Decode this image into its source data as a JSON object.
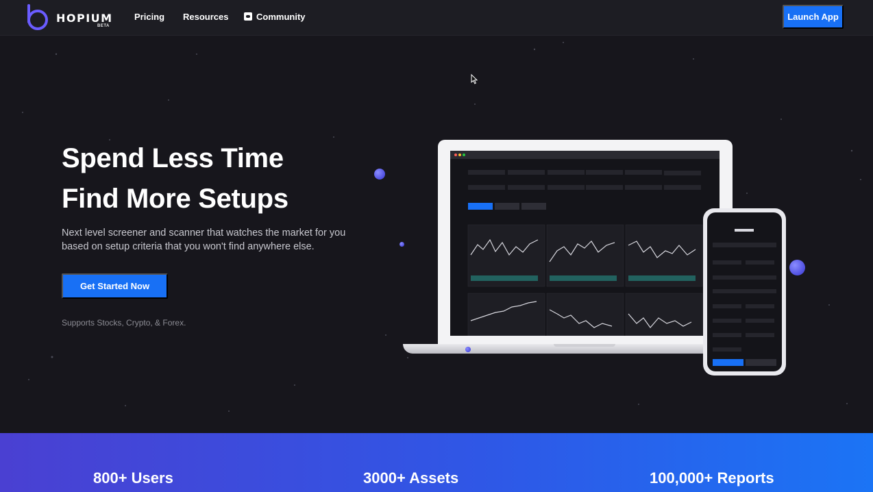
{
  "nav": {
    "logo_text": "HOPIUM",
    "logo_badge": "BETA",
    "links": [
      "Pricing",
      "Resources",
      "Community"
    ],
    "launch_label": "Launch App"
  },
  "hero": {
    "title_line1": "Spend Less Time",
    "title_line2": "Find More Setups",
    "subtitle": "Next level screener and scanner that watches the market for you based on setup criteria that you won't find anywhere else.",
    "cta_label": "Get Started Now",
    "supports": "Supports Stocks, Crypto, & Forex."
  },
  "stats": {
    "users": "800+ Users",
    "assets": "3000+ Assets",
    "reports": "100,000+ Reports"
  },
  "colors": {
    "accent": "#1870f5",
    "background": "#17161c",
    "nav_background": "#1d1d23",
    "dot": "#5c5cf0"
  },
  "icons": [
    "discord-icon",
    "cursor-icon",
    "logo-mark-icon"
  ]
}
